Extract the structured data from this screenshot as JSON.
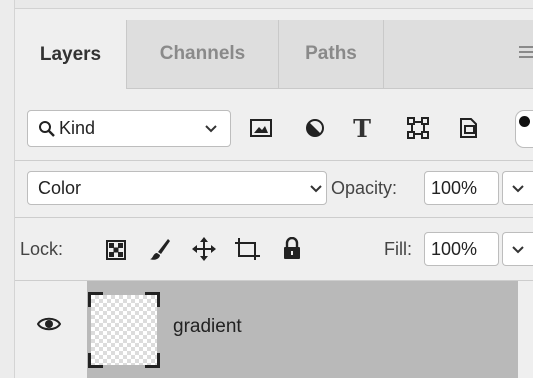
{
  "tabs": [
    {
      "label": "Layers",
      "active": true
    },
    {
      "label": "Channels",
      "active": false
    },
    {
      "label": "Paths",
      "active": false
    }
  ],
  "filter": {
    "icon": "search-icon",
    "value": "Kind"
  },
  "filter_icons": [
    "image-filter-icon",
    "adjustment-filter-icon",
    "type-filter-icon",
    "shape-filter-icon",
    "smart-object-filter-icon",
    "filter-toggle-icon"
  ],
  "blend_mode": "Color",
  "opacity": {
    "label": "Opacity:",
    "value": "100%"
  },
  "lock": {
    "label": "Lock:",
    "icons": [
      "lock-transparent-pixels-icon",
      "lock-image-pixels-icon",
      "lock-position-icon",
      "lock-artboard-icon",
      "lock-all-icon"
    ]
  },
  "fill": {
    "label": "Fill:",
    "value": "100%"
  },
  "layers": [
    {
      "name": "gradient",
      "visible": true,
      "selected": true
    }
  ],
  "colors": {
    "selected_row": "#b9b9b9",
    "panel_bg": "#efefef",
    "tab_bg": "#dedede"
  }
}
